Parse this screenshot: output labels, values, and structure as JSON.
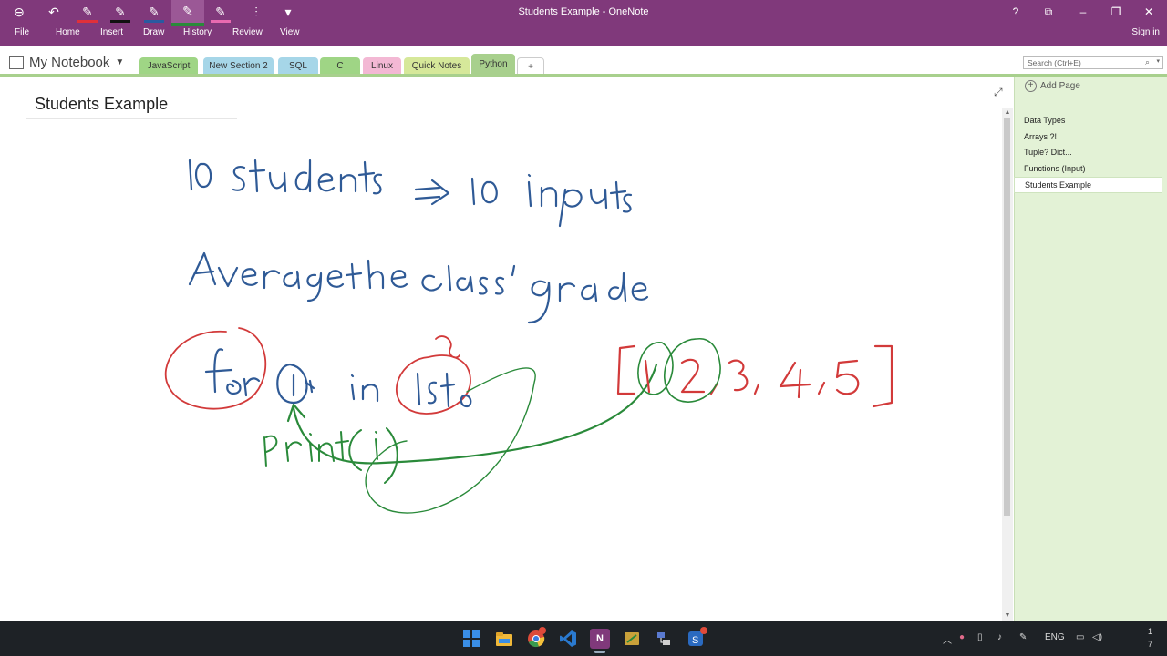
{
  "window": {
    "title": "Students Example - OneNote"
  },
  "quick_access": [
    {
      "name": "back-icon",
      "glyph": "⊖"
    },
    {
      "name": "undo-icon",
      "glyph": "↶"
    },
    {
      "name": "red-pen-icon",
      "glyph": "✎"
    },
    {
      "name": "black-pen-icon",
      "glyph": "✎"
    },
    {
      "name": "blue-pen-icon",
      "glyph": "✎"
    },
    {
      "name": "green-pen-icon",
      "glyph": "✎"
    },
    {
      "name": "pink-pen-icon",
      "glyph": "✎"
    },
    {
      "name": "pen-set-icon",
      "glyph": "⫶"
    },
    {
      "name": "customize-icon",
      "glyph": "▾"
    }
  ],
  "ribbon": {
    "tabs": [
      "File",
      "Home",
      "Insert",
      "Draw",
      "History",
      "Review",
      "View"
    ],
    "signin": "Sign in",
    "window_buttons": [
      "?",
      "⧉",
      "–",
      "❐",
      "✕"
    ]
  },
  "notebook": {
    "name": "My Notebook"
  },
  "sections": [
    {
      "label": "JavaScript",
      "color": "#9fd585"
    },
    {
      "label": "New Section 2",
      "color": "#a6d6e8"
    },
    {
      "label": "SQL",
      "color": "#a6d6e8"
    },
    {
      "label": "C",
      "color": "#9fd585"
    },
    {
      "label": "Linux",
      "color": "#f3b8d4"
    },
    {
      "label": "Quick Notes",
      "color": "#d6e89a"
    },
    {
      "label": "Python",
      "color": "#a8d08d"
    },
    {
      "label": "+",
      "color": "#ffffff"
    }
  ],
  "search": {
    "placeholder": "Search (Ctrl+E)"
  },
  "page": {
    "title": "Students Example"
  },
  "page_pane": {
    "add_page": "Add Page",
    "pages": [
      "Data Types",
      "Arrays ?!",
      "Tuple? Dict...",
      "Functions (Input)",
      "Students Example"
    ],
    "selected": "Students Example"
  },
  "taskbar": {
    "apps": [
      {
        "name": "windows-start-icon",
        "color": "#3a8ee6"
      },
      {
        "name": "file-explorer-icon",
        "color": "#f0b93a"
      },
      {
        "name": "chrome-icon",
        "color": "#3a9a4e"
      },
      {
        "name": "vscode-icon",
        "color": "#2a7ad0"
      },
      {
        "name": "onenote-icon",
        "color": "#80397b"
      },
      {
        "name": "notes-app-icon",
        "color": "#c9a13a"
      },
      {
        "name": "network-app-icon",
        "color": "#5a7ad0"
      },
      {
        "name": "snagit-icon",
        "color": "#2a6ac0"
      }
    ],
    "tray": {
      "language": "ENG",
      "time": "1",
      "date": "7"
    }
  }
}
